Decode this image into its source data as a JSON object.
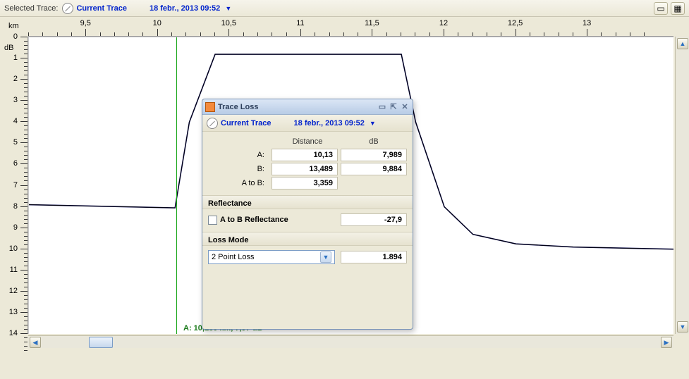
{
  "toolbar": {
    "label": "Selected Trace:",
    "trace_name": "Current Trace",
    "timestamp": "18 febr., 2013 09:52"
  },
  "axes": {
    "x_unit": "km",
    "y_unit": "dB",
    "x_ticks": [
      9.5,
      10,
      10.5,
      11,
      11.5,
      12,
      12.5,
      13
    ],
    "x_labels": [
      "9,5",
      "10",
      "10,5",
      "11",
      "11,5",
      "12",
      "12,5",
      "13"
    ],
    "y_ticks": [
      0,
      1,
      2,
      3,
      4,
      5,
      6,
      7,
      8,
      9,
      10,
      11,
      12,
      13,
      14
    ]
  },
  "cursor_status": "A: 10,130 km, 7,97 dB",
  "dialog": {
    "title": "Trace Loss",
    "trace_name": "Current Trace",
    "timestamp": "18 febr., 2013 09:52",
    "col_distance": "Distance",
    "col_db": "dB",
    "row_a": "A:",
    "row_b": "B:",
    "row_atob": "A to B:",
    "a_dist": "10,13",
    "a_db": "7,989",
    "b_dist": "13,489",
    "b_db": "9,884",
    "atob_dist": "3,359",
    "reflectance_label": "Reflectance",
    "atob_reflectance_label": "A to B Reflectance",
    "reflectance_val": "-27,9",
    "loss_mode_label": "Loss Mode",
    "loss_mode_selected": "2 Point Loss",
    "loss_val": "1.894"
  },
  "chart_data": {
    "type": "line",
    "xlabel": "km",
    "ylabel": "dB",
    "xlim": [
      9.1,
      13.6
    ],
    "ylim": [
      14,
      0
    ],
    "cursor_a_x": 10.13,
    "series": [
      {
        "name": "trace",
        "x": [
          9.1,
          10.12,
          10.22,
          10.4,
          11.7,
          11.8,
          12.0,
          12.2,
          12.5,
          12.9,
          13.6
        ],
        "y": [
          7.9,
          8.05,
          4.0,
          0.8,
          0.8,
          4.0,
          8.0,
          9.3,
          9.75,
          9.9,
          10.0
        ]
      }
    ]
  }
}
